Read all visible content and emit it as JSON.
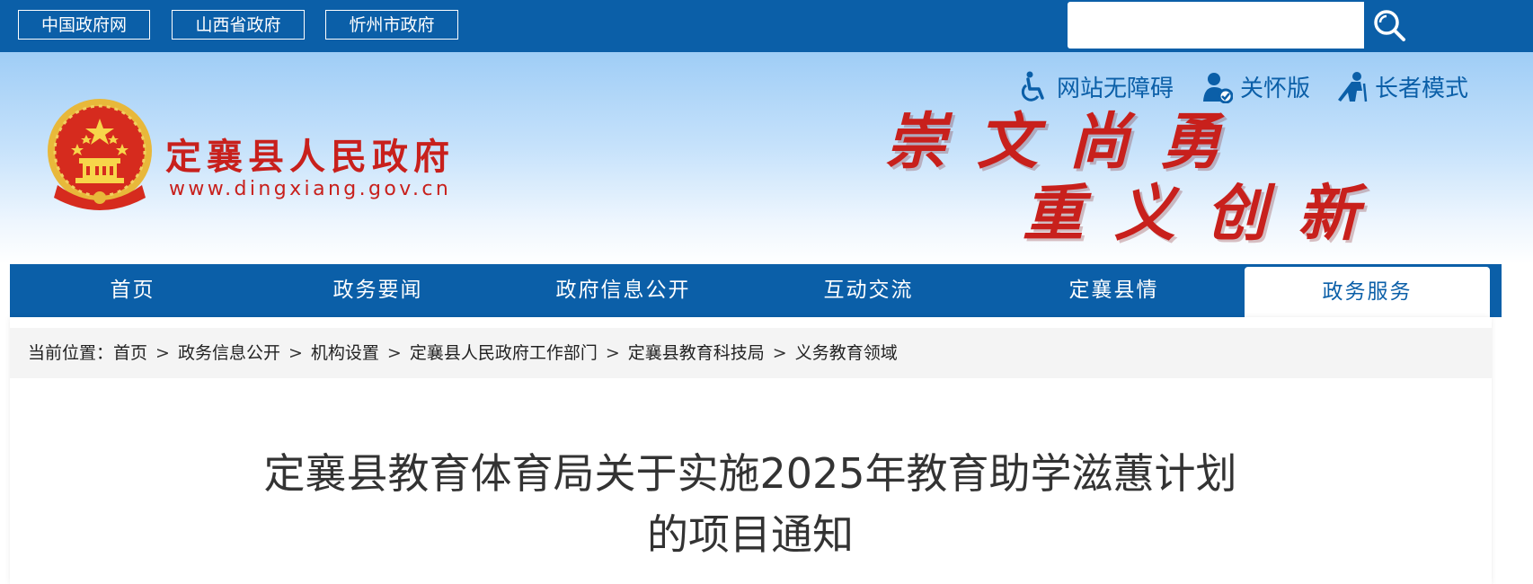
{
  "topbar": {
    "links": [
      "中国政府网",
      "山西省政府",
      "忻州市政府"
    ],
    "search_placeholder": ""
  },
  "banner": {
    "site_name": "定襄县人民政府",
    "site_url": "www.dingxiang.gov.cn",
    "slogan_line1": "崇文尚勇",
    "slogan_line2": "重义创新",
    "tools": {
      "accessibility": "网站无障碍",
      "care": "关怀版",
      "elder": "长者模式"
    }
  },
  "nav": {
    "items": [
      "首页",
      "政务要闻",
      "政府信息公开",
      "互动交流",
      "定襄县情",
      "政务服务"
    ],
    "active_index": 5
  },
  "breadcrumb": {
    "prefix": "当前位置：",
    "items": [
      "首页",
      "政务信息公开",
      "机构设置",
      "定襄县人民政府工作部门",
      "定襄县教育科技局",
      "义务教育领域"
    ],
    "separator": ">"
  },
  "article": {
    "title_line1": "定襄县教育体育局关于实施2025年教育助学滋蕙计划",
    "title_line2": "的项目通知"
  },
  "colors": {
    "brand_blue": "#0b5fa8",
    "brand_red": "#c8201c"
  }
}
